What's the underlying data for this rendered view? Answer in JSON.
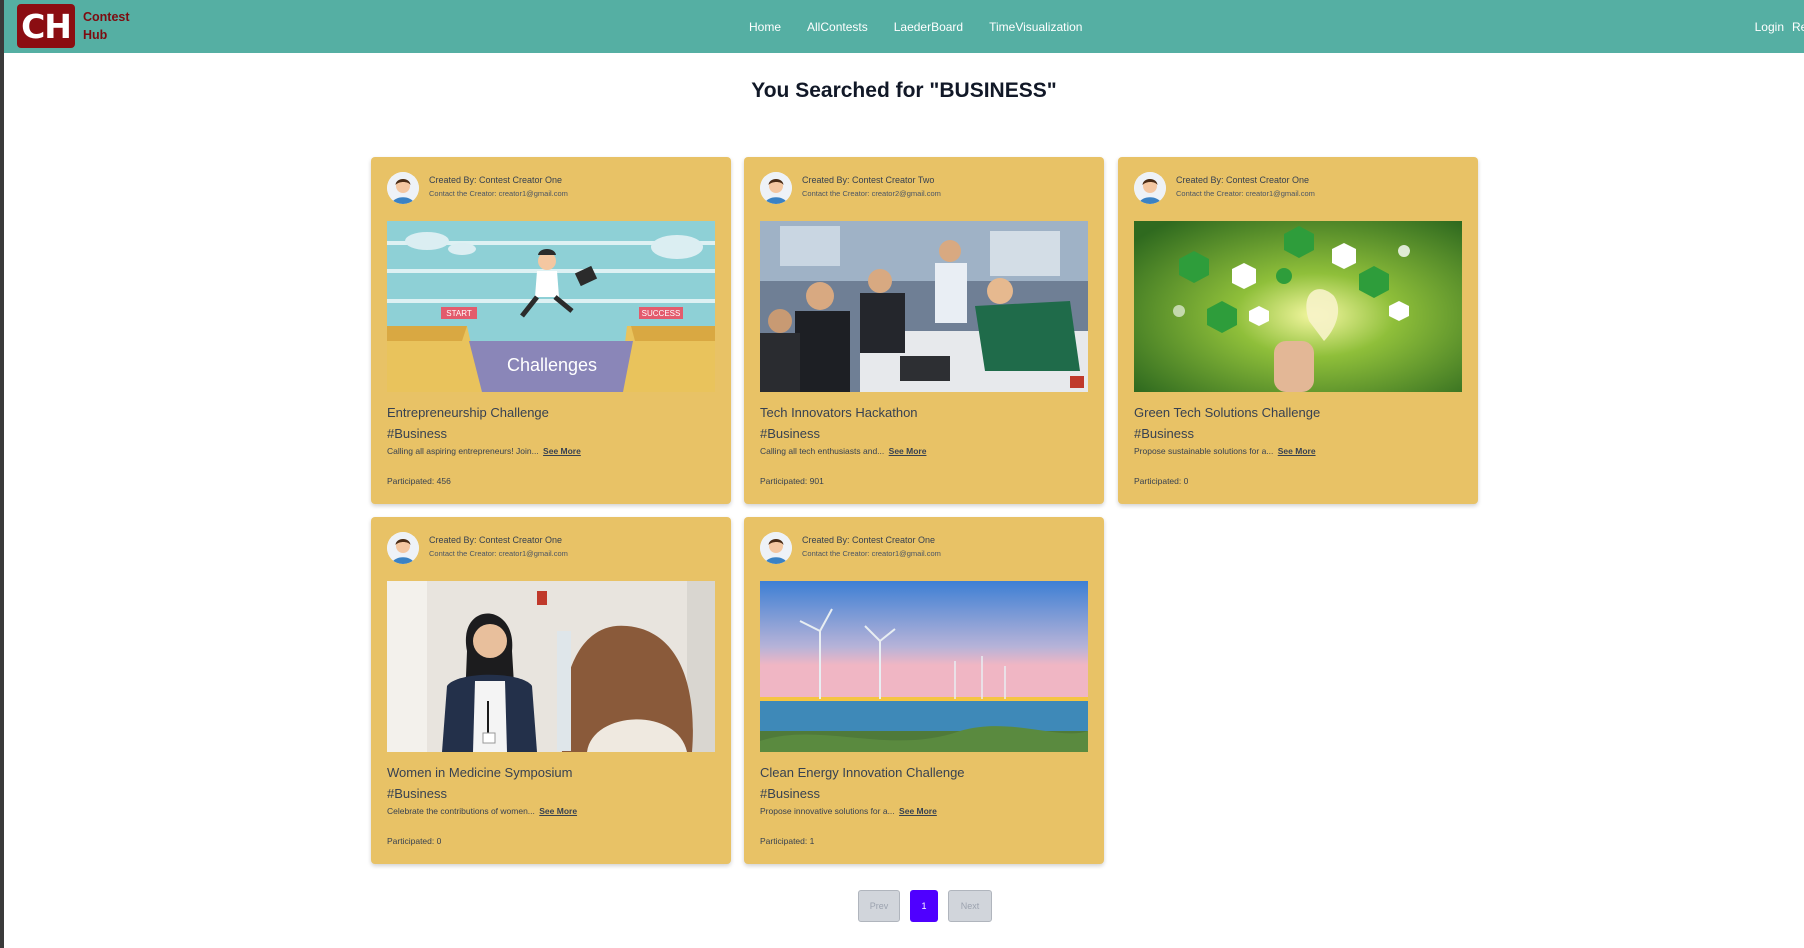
{
  "navbar": {
    "logo_text": "CH",
    "brand_line1": "Contest",
    "brand_line2": "Hub",
    "links": [
      "Home",
      "AllContests",
      "LaederBoard",
      "TimeVisualization"
    ],
    "login": "Login",
    "register_partial": "Re"
  },
  "heading": "You Searched for \"BUSINESS\"",
  "cards": [
    {
      "creator": "Created By: Contest Creator One",
      "contact": "Contact the Creator: creator1@gmail.com",
      "title": "Entrepreneurship Challenge",
      "tag": "#Business",
      "desc": "Calling all aspiring entrepreneurs! Join...",
      "see_more": "See More",
      "participated": "Participated: 456",
      "image_text": "Challenges",
      "image_sign_start": "START",
      "image_sign_success": "SUCCESS"
    },
    {
      "creator": "Created By: Contest Creator Two",
      "contact": "Contact the Creator: creator2@gmail.com",
      "title": "Tech Innovators Hackathon",
      "tag": "#Business",
      "desc": "Calling all tech enthusiasts and...",
      "see_more": "See More",
      "participated": "Participated: 901"
    },
    {
      "creator": "Created By: Contest Creator One",
      "contact": "Contact the Creator: creator1@gmail.com",
      "title": "Green Tech Solutions Challenge",
      "tag": "#Business",
      "desc": "Propose sustainable solutions for a...",
      "see_more": "See More",
      "participated": "Participated: 0"
    },
    {
      "creator": "Created By: Contest Creator One",
      "contact": "Contact the Creator: creator1@gmail.com",
      "title": "Women in Medicine Symposium",
      "tag": "#Business",
      "desc": "Celebrate the contributions of women...",
      "see_more": "See More",
      "participated": "Participated: 0"
    },
    {
      "creator": "Created By: Contest Creator One",
      "contact": "Contact the Creator: creator1@gmail.com",
      "title": "Clean Energy Innovation Challenge",
      "tag": "#Business",
      "desc": "Propose innovative solutions for a...",
      "see_more": "See More",
      "participated": "Participated: 1"
    }
  ],
  "pagination": {
    "prev": "Prev",
    "current": "1",
    "next": "Next"
  },
  "colors": {
    "navbar": "#55afa3",
    "logo": "#8b0d12",
    "card": "#e8c266",
    "active_page": "#4f00ff"
  }
}
